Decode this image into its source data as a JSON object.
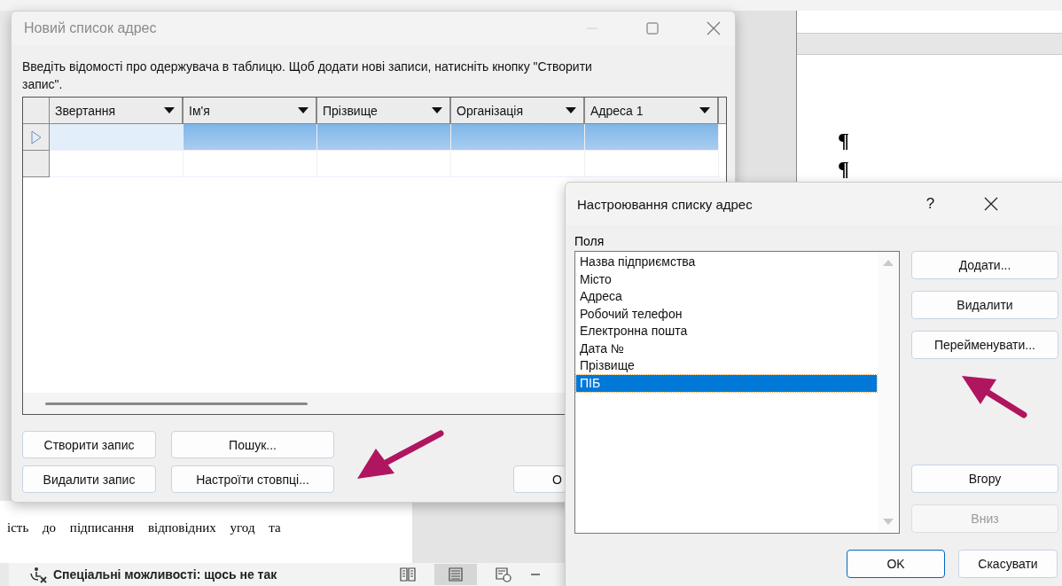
{
  "background_document": {
    "paragraph_marks": [
      "¶",
      "¶"
    ],
    "text_line": "ість до підписання відповідних угод та"
  },
  "status_bar": {
    "accessibility": "Спеціальні можливості: щось не так"
  },
  "address_list_window": {
    "title": "Новий список адрес",
    "instructions": "Введіть відомості про одержувача в таблицю.  Щоб додати нові записи, натисніть кнопку \"Створити запис\".",
    "columns": [
      "Звертання",
      "Ім'я",
      "Прізвище",
      "Організація",
      "Адреса 1"
    ],
    "rows": [
      {
        "selected": true
      },
      {
        "selected": false
      }
    ],
    "buttons": [
      {
        "label": "Створити запис"
      },
      {
        "label": "Пошук..."
      },
      {
        "label": "Видалити запис"
      },
      {
        "label": "Настроїти стовпці..."
      }
    ],
    "partial_button": "О"
  },
  "customize_dialog": {
    "title": "Настроювання списку адрес",
    "help": "?",
    "fields_label": "Поля",
    "fields": [
      {
        "label": "Назва підприємства",
        "selected": false
      },
      {
        "label": "Місто",
        "selected": false
      },
      {
        "label": "Адреса",
        "selected": false
      },
      {
        "label": "Робочий телефон",
        "selected": false
      },
      {
        "label": "Електронна пошта",
        "selected": false
      },
      {
        "label": "Дата №",
        "selected": false
      },
      {
        "label": "Прізвище",
        "selected": false
      },
      {
        "label": "ПІБ",
        "selected": true
      }
    ],
    "buttons": [
      {
        "label": "Додати...",
        "disabled": false
      },
      {
        "label": "Видалити",
        "disabled": false
      },
      {
        "label": "Перейменувати...",
        "disabled": false
      },
      {
        "label": "Вгору",
        "disabled": false
      },
      {
        "label": "Вниз",
        "disabled": true
      }
    ],
    "ok": "OK",
    "cancel": "Скасувати"
  }
}
